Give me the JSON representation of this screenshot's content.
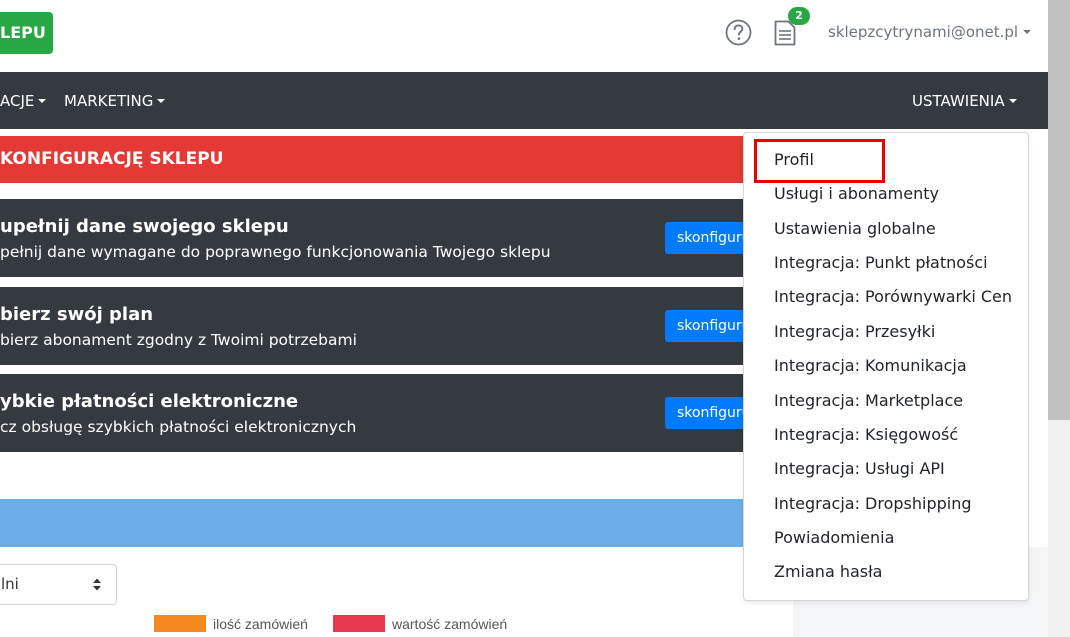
{
  "header": {
    "shop_button": "LEPU",
    "notification_count": "2",
    "user_email": "sklepzcytrynami@onet.pl"
  },
  "nav": {
    "items": [
      "ACJE",
      "MARKETING"
    ],
    "settings": "USTAWIENIA"
  },
  "main": {
    "banner": "KONFIGURACJĘ SKLEPU",
    "cards": [
      {
        "title": "upełnij dane swojego sklepu",
        "desc": "pełnij dane wymagane do poprawnego funkcjonowania Twojego sklepu",
        "button": "skonfiguruj"
      },
      {
        "title": "bierz swój plan",
        "desc": "bierz abonament zgodny z Twoimi potrzebami",
        "button": "skonfiguruj"
      },
      {
        "title": "ybkie płatności elektroniczne",
        "desc": "cz obsługę szybkich płatności elektronicznych",
        "button": "skonfiguruj"
      }
    ],
    "select_value": "lni",
    "legend": [
      "ilość zamówień",
      "wartość zamówień"
    ]
  },
  "dropdown": {
    "items": [
      "Profil",
      "Usługi i abonamenty",
      "Ustawienia globalne",
      "Integracja: Punkt płatności",
      "Integracja: Porównywarki Cen",
      "Integracja: Przesyłki",
      "Integracja: Komunikacja",
      "Integracja: Marketplace",
      "Integracja: Księgowość",
      "Integracja: Usługi API",
      "Integracja: Dropshipping",
      "Powiadomienia",
      "Zmiana hasła"
    ]
  },
  "colors": {
    "success": "#28a745",
    "nav_dark": "#343a40",
    "danger_banner": "#e53935",
    "primary": "#007bff",
    "info_bar": "#6aaee8",
    "legend_orders": "#f5891e",
    "legend_value": "#e6394f",
    "highlight": "#e60000"
  },
  "icons": [
    "help-circle-icon",
    "document-icon",
    "caret-down-icon",
    "select-arrows-icon"
  ]
}
